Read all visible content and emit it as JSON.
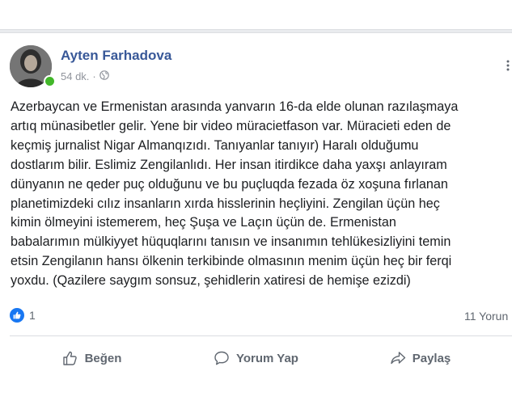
{
  "post": {
    "author": "Ayten Farhadova",
    "time": "54 dk.",
    "separator": "·",
    "text": "Azerbaycan ve Ermenistan arasında yanvarın 16-da elde olunan razılaşmaya\nartıq münasibetler gelir. Yene bir video müracietfason var. Müracieti eden de\nkeçmiş jurnalist Nigar Almanqızıdı. Tanıyanlar tanıyır) Haralı olduğumu\ndostlarım bilir. Eslimiz Zengilanlıdı. Her insan itirdikce daha yaxşı anlayıram\ndünyanın ne qeder puç olduğunu ve bu puçluqda fezada öz xoşuna fırlanan\nplanetimizdeki cılız insanların xırda hisslerinin heçliyini. Zengilan üçün heç\nkimin ölmeyini istemerem, heç Şuşa ve Laçın üçün de. Ermenistan\nbabalarımın mülkiyyet hüquqlarını tanısın ve insanımın tehlükesizliyini temin\netsin Zengilanın hansı ölkenin terkibinde olmasının menim üçün heç bir ferqi\nyoxdu. (Qazilere saygım sonsuz, şehidlerin xatiresi de hemişe ezizdi)",
    "reaction_count": "1",
    "comment_count": "11 Yorun"
  },
  "actions": {
    "like": "Beğen",
    "comment": "Yorum Yap",
    "share": "Paylaş"
  },
  "icons": {
    "privacy": "globe-icon",
    "like": "thumbs-up-icon",
    "comment": "speech-bubble-icon",
    "share": "share-arrow-icon",
    "reaction": "like-reaction-icon"
  },
  "colors": {
    "name": "#385898",
    "meta": "#90949c",
    "text": "#1c1e21",
    "action": "#606770",
    "like_badge": "#1877f2",
    "online": "#42b72a"
  }
}
